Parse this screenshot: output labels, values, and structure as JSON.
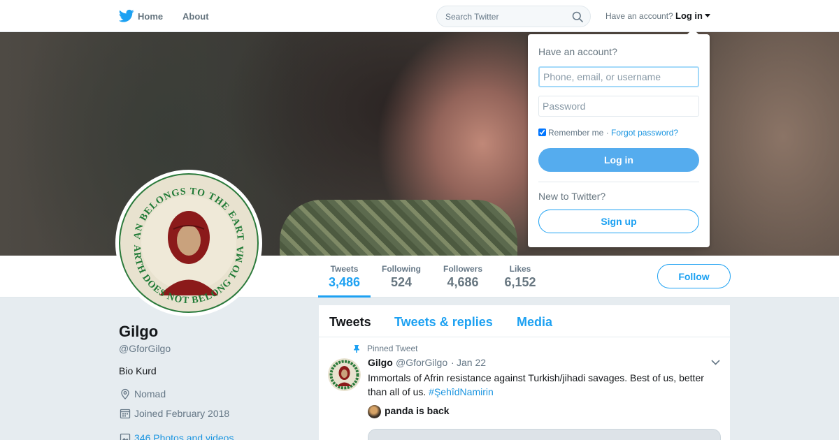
{
  "nav": {
    "home_label": "Home",
    "about_label": "About",
    "search_placeholder": "Search Twitter",
    "have_account_text": "Have an account?",
    "login_label": "Log in"
  },
  "colors": {
    "accent": "#1da1f2",
    "login_button": "#55acee",
    "link": "#1b95e0"
  },
  "stats": [
    {
      "label": "Tweets",
      "value": "3,486",
      "active": true
    },
    {
      "label": "Following",
      "value": "524"
    },
    {
      "label": "Followers",
      "value": "4,686"
    },
    {
      "label": "Likes",
      "value": "6,152"
    }
  ],
  "follow_label": "Follow",
  "avatar": {
    "circle_text_top": "MAN BELONGS TO THE EARTH",
    "circle_text_bottom": "EARTH DOES NOT BELONG TO MAN"
  },
  "profile": {
    "name": "Gilgo",
    "handle": "@GforGilgo",
    "bio": "Bio Kurd",
    "location": "Nomad",
    "joined": "Joined February 2018",
    "photos": "346 Photos and videos"
  },
  "timeline": {
    "tabs": [
      "Tweets",
      "Tweets & replies",
      "Media"
    ],
    "pinned_label": "Pinned Tweet",
    "tweet": {
      "name": "Gilgo",
      "handle": "@GforGilgo",
      "separator": "·",
      "date": "Jan 22",
      "text": "Immortals of Afrin resistance against Turkish/jihadi savages. Best of us, better than all of us.",
      "hashtag": "#ŞehîdNamirin",
      "quote_name": "panda is back"
    }
  },
  "login_dropdown": {
    "title": "Have an account?",
    "username_placeholder": "Phone, email, or username",
    "password_placeholder": "Password",
    "remember_label": "Remember me",
    "separator": "·",
    "forgot_label": "Forgot password?",
    "remember_checked": true,
    "login_button": "Log in",
    "new_to_label": "New to Twitter?",
    "signup_button": "Sign up"
  }
}
